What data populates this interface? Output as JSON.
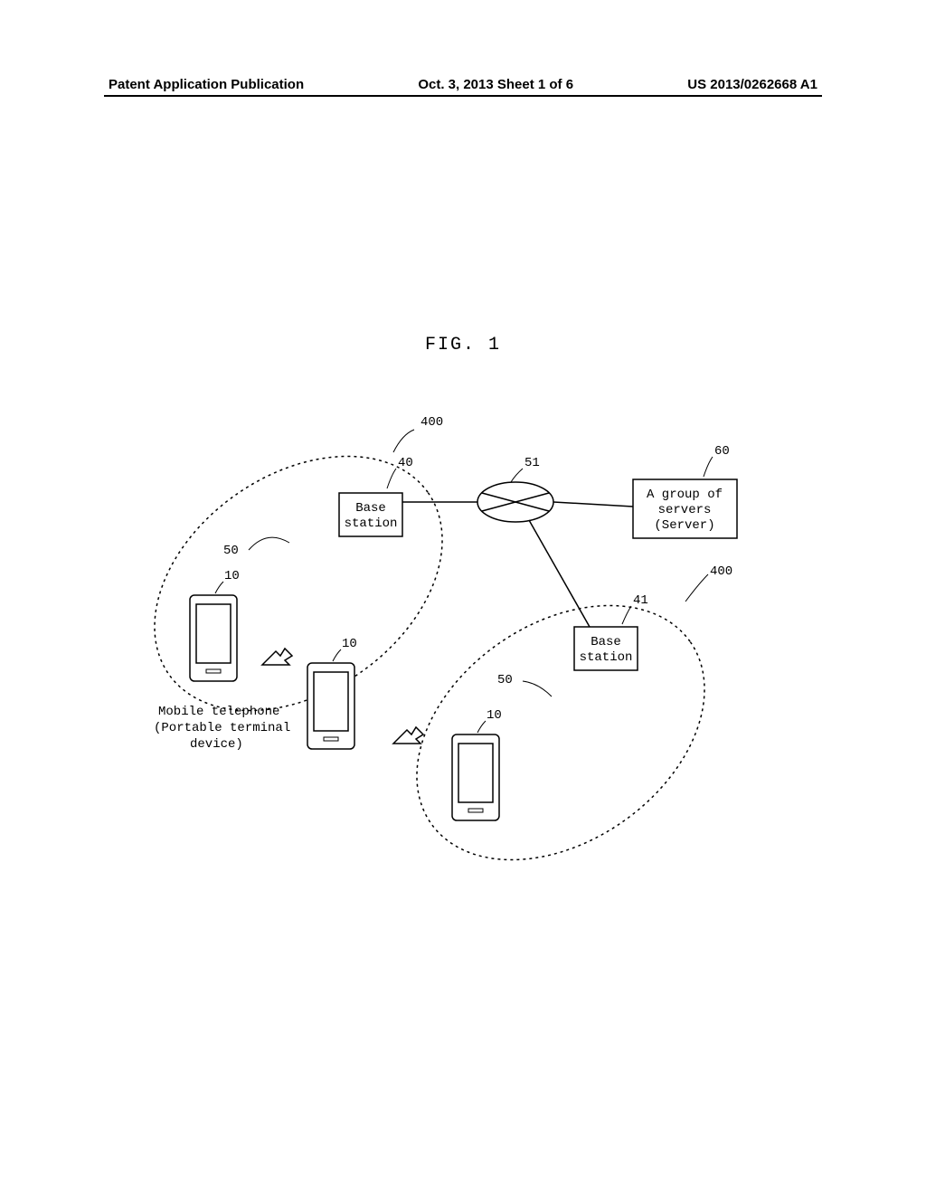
{
  "header": {
    "left": "Patent Application Publication",
    "center": "Oct. 3, 2013   Sheet 1 of 6",
    "right": "US 2013/0262668 A1"
  },
  "figure_label": "FIG. 1",
  "labels": {
    "ref_400_a": "400",
    "ref_400_b": "400",
    "ref_40": "40",
    "ref_41": "41",
    "ref_50_a": "50",
    "ref_50_b": "50",
    "ref_51": "51",
    "ref_60": "60",
    "ref_10_a": "10",
    "ref_10_b": "10",
    "ref_10_c": "10",
    "base_station_1": "Base",
    "base_station_2": "station",
    "servers_1": "A group of",
    "servers_2": "servers",
    "servers_3": "(Server)",
    "mobile_1": "Mobile telephone",
    "mobile_2": "(Portable terminal",
    "mobile_3": "device)"
  }
}
